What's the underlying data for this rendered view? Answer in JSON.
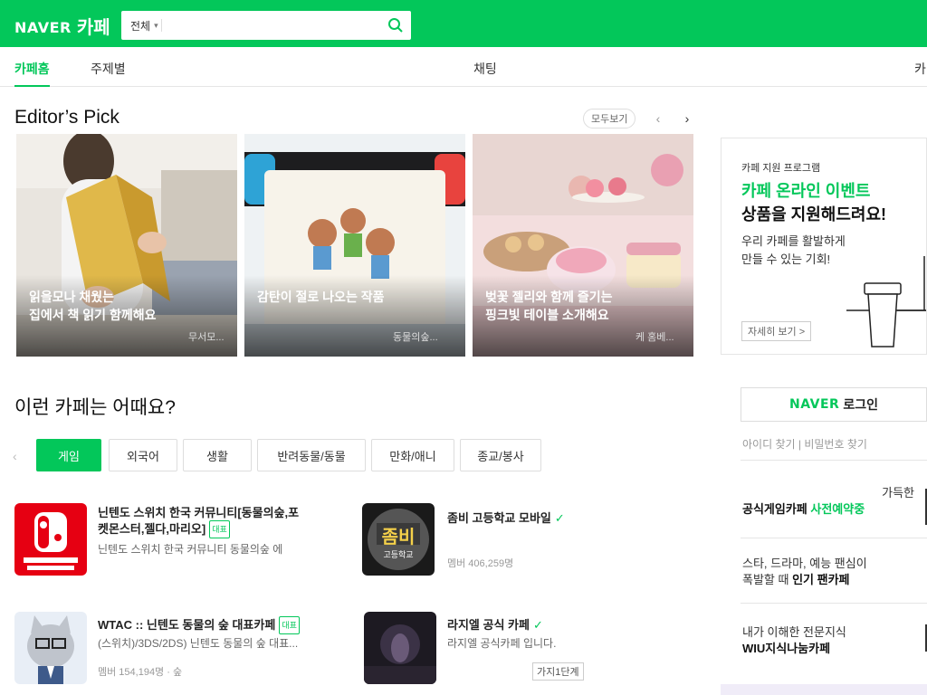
{
  "header": {
    "logo_naver": "NAVER",
    "logo_cafe": "카페",
    "search_scope": "전체",
    "search_placeholder": "",
    "accent": "#03c75a"
  },
  "nav": {
    "items": [
      "카페홈",
      "주제별",
      "",
      "",
      "",
      "",
      "채팅",
      "카"
    ],
    "active_index": 0
  },
  "editors_pick": {
    "title": "Editor’s Pick",
    "more_label": "모두보기",
    "prev_icon": "chevron-left-icon",
    "next_icon": "chevron-right-icon",
    "cards": [
      {
        "title_line1": "읽을모나 채웠는",
        "title_line2": "집에서 책 읽기 함께해요",
        "meta": "무서모...",
        "image": "person-reading-book"
      },
      {
        "title_line1": "감탄이 절로 나오는 작품",
        "title_line2": "",
        "meta": "동물의숲...",
        "image": "cross-stitch-switch"
      },
      {
        "title_line1": "벚꽃 젤리와 함께 즐기는",
        "title_line2": "핑크빛 테이블 소개해요",
        "meta": "케 홈베...",
        "image": "pink-dessert-table"
      }
    ]
  },
  "promo": {
    "tag": "카페 지원 프로그램",
    "headline1": "카페 온라인 이벤트",
    "headline2": "상품을 지원해드려요!",
    "desc_line1": "우리 카페를 활발하게",
    "desc_line2": "만들 수 있는 기회!",
    "link_label": "자세히 보기 >"
  },
  "recommend": {
    "title": "이런 카페는 어때요?",
    "tabs": [
      "게임",
      "외국어",
      "생활",
      "반려동물/동물",
      "만화/애니",
      "종교/봉사"
    ],
    "active_index": 0,
    "cafes": [
      {
        "name_line1": "닌텐도 스위치 한국 커뮤니티[동물의숲,포",
        "name_line2": "켓몬스터,젤다,마리오]",
        "badge": "대표",
        "desc": "닌텐도 스위치 한국 커뮤니티 동물의숲 에",
        "members": "",
        "thumb": "nintendo-switch-logo"
      },
      {
        "name_line1": "좀비 고등학교 모바일",
        "name_line2": "",
        "badge": "",
        "desc": "",
        "members": "멤버 406,259명",
        "thumb": "zombie-high-school-logo",
        "verified": true
      },
      {
        "name_line1": "WTAC :: 닌텐도 동물의 숲 대표카페",
        "name_line2": "",
        "badge": "대표",
        "desc": "(스위치)/3DS/2DS) 닌텐도 동물의 숲 대표...",
        "members": "멤버 154,194명 · 숲",
        "thumb": "raymond-cat-avatar"
      },
      {
        "name_line1": "라지엘 공식 카페",
        "name_line2": "",
        "badge": "",
        "desc": "라지엘 공식카페 입니다.",
        "members": "",
        "grade": "가지1단계",
        "thumb": "raziel-dark-art",
        "verified": true
      }
    ]
  },
  "sidebar": {
    "login_naver": "NAVER",
    "login_label": "로그인",
    "find_id": "아이디 찾기",
    "find_pw": "비밀번호 찾기",
    "item1_line1": "가득한",
    "item1_green": "공식게임카페",
    "item1_extra": "사전예약중",
    "item2_line1": "스타, 드라마, 예능 팬심이",
    "item2_line2a": "폭발할 때 ",
    "item2_line2b": "인기 팬카페",
    "item3_line1": "내가 이해한 전문지식",
    "item3_line2": "WIU지식나눔카페"
  }
}
